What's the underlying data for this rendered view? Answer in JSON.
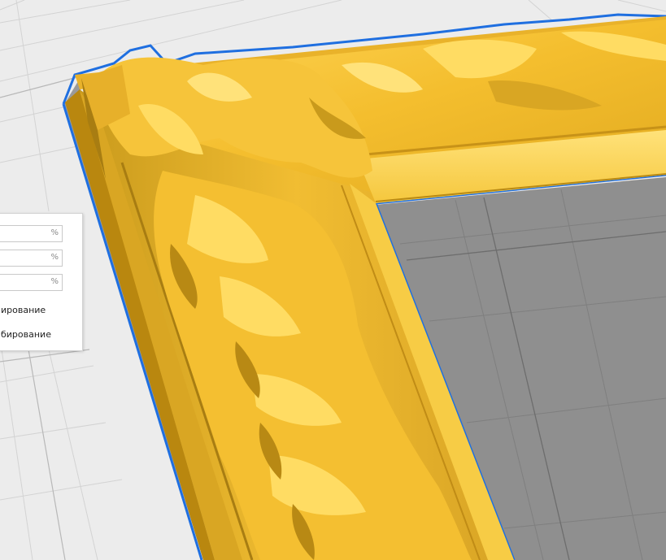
{
  "viewport": {
    "background": "#ececec",
    "grid_color": "#cfcfcf",
    "floor_shadow_color": "#8e8e8e",
    "model_color": "#f2bf34",
    "model_highlight": "#ffde66",
    "model_shade": "#b88914",
    "selection_outline_color": "#1f6fe0"
  },
  "scale_panel": {
    "fields": [
      {
        "value": "",
        "unit": "%"
      },
      {
        "value": "",
        "unit": "%"
      },
      {
        "value": "",
        "unit": "%"
      }
    ],
    "option_1_label": "ирование",
    "option_2_label": "бирование"
  }
}
